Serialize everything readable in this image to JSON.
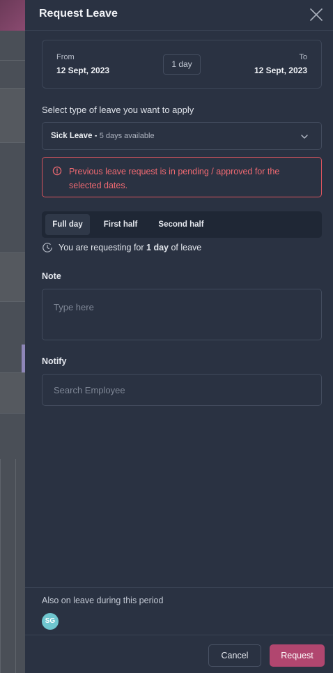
{
  "drawer": {
    "title": "Request Leave"
  },
  "dates": {
    "from_label": "From",
    "from_value": "12 Sept, 2023",
    "to_label": "To",
    "to_value": "12 Sept, 2023",
    "duration": "1 day"
  },
  "leave_type": {
    "label": "Select type of leave you want to apply",
    "selected": "Sick Leave -",
    "availability": "5 days available"
  },
  "alert": {
    "message": "Previous leave request is in pending / approved for the selected dates."
  },
  "day_options": {
    "items": [
      {
        "label": "Full day",
        "active": true
      },
      {
        "label": "First half",
        "active": false
      },
      {
        "label": "Second half",
        "active": false
      }
    ]
  },
  "summary": {
    "prefix": "You are requesting for ",
    "amount": "1 day",
    "suffix": " of leave"
  },
  "note": {
    "label": "Note",
    "placeholder": "Type here"
  },
  "notify": {
    "label": "Notify",
    "placeholder": "Search Employee"
  },
  "also_on_leave": {
    "label": "Also on leave during this period",
    "people": [
      {
        "initials": "SG",
        "color": "#6fc6cf"
      }
    ]
  },
  "actions": {
    "cancel_label": "Cancel",
    "request_label": "Request"
  },
  "colors": {
    "drawer_bg": "#2a3242",
    "accent": "#b1466f",
    "error": "#f06a72"
  }
}
